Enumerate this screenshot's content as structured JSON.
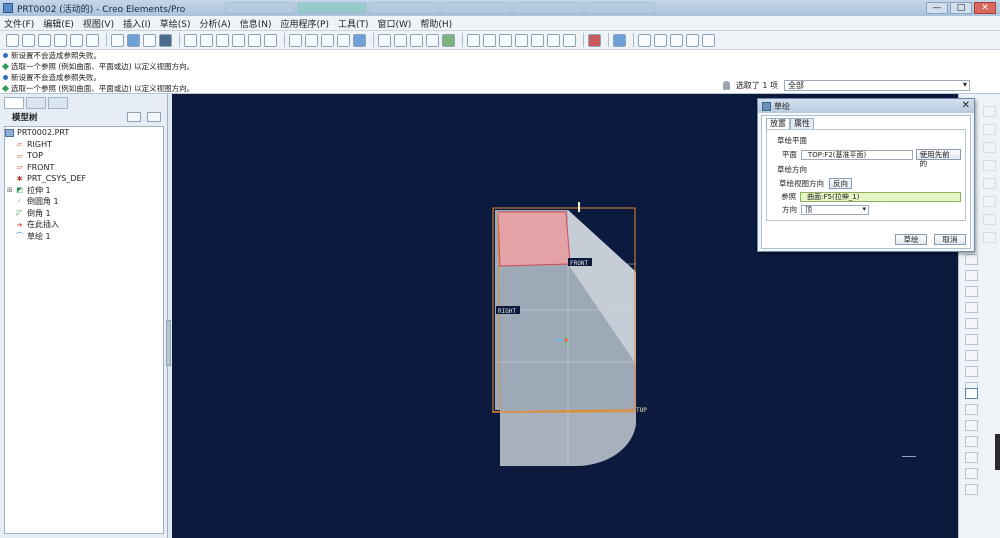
{
  "window": {
    "title": "PRT0002 (活动的) - Creo Elements/Pro",
    "controls": {
      "minimize": "—",
      "maximize": "□",
      "close": "✕"
    }
  },
  "menubar": {
    "items": [
      "文件(F)",
      "编辑(E)",
      "视图(V)",
      "插入(I)",
      "草绘(S)",
      "分析(A)",
      "信息(N)",
      "应用程序(P)",
      "工具(T)",
      "窗口(W)",
      "帮助(H)"
    ]
  },
  "messages": [
    {
      "kind": "info",
      "text": "新设置不会造成参照失败。"
    },
    {
      "kind": "prompt",
      "text": "选取一个参照 (例如曲面、平面或边) 以定义视图方向。"
    },
    {
      "kind": "info",
      "text": "新设置不会造成参照失败。"
    },
    {
      "kind": "prompt",
      "text": "选取一个参照 (例如曲面、平面或边) 以定义视图方向。"
    }
  ],
  "selection": {
    "status": "选取了 1 项",
    "filter": "全部"
  },
  "model_tree": {
    "title": "模型树",
    "items": [
      {
        "label": "PRT0002.PRT",
        "icon": "part-icon",
        "indent": 0,
        "expandable": false
      },
      {
        "label": "RIGHT",
        "icon": "datum-plane-icon",
        "indent": 1,
        "expandable": false
      },
      {
        "label": "TOP",
        "icon": "datum-plane-icon",
        "indent": 1,
        "expandable": false
      },
      {
        "label": "FRONT",
        "icon": "datum-plane-icon",
        "indent": 1,
        "expandable": false
      },
      {
        "label": "PRT_CSYS_DEF",
        "icon": "csys-icon",
        "indent": 1,
        "expandable": false
      },
      {
        "label": "拉伸 1",
        "icon": "extrude-icon",
        "indent": 1,
        "expandable": true
      },
      {
        "label": "倒圆角 1",
        "icon": "round-icon",
        "indent": 1,
        "expandable": false
      },
      {
        "label": "倒角 1",
        "icon": "chamfer-icon",
        "indent": 1,
        "expandable": false
      },
      {
        "label": "在此插入",
        "icon": "insert-here-icon",
        "indent": 1,
        "expandable": false
      },
      {
        "label": "草绘 1",
        "icon": "sketch-icon",
        "indent": 1,
        "expandable": false
      }
    ]
  },
  "viewport": {
    "datum_labels": {
      "front": "FRONT",
      "right": "RIGHT",
      "top": "TOP"
    },
    "colors": {
      "background": "#0b1a3d",
      "body": "#a9b3c0",
      "highlight": "#e3a2a6",
      "datum": "#e08b2e"
    }
  },
  "sketch_dialog": {
    "title": "草绘",
    "tabs": [
      "放置",
      "属性"
    ],
    "active_tab": "放置",
    "sketch_plane": {
      "heading": "草绘平面",
      "plane_label": "平面",
      "plane_value": "TOP:F2(基准平面)",
      "use_previous": "使用先前的"
    },
    "orientation": {
      "heading": "草绘方向",
      "view_dir_label": "草绘视图方向",
      "flip": "反向",
      "reference_label": "参照",
      "reference_value": "曲面:F5(拉伸_1)",
      "direction_label": "方向",
      "direction_value": "顶"
    },
    "ok": "草绘",
    "cancel": "取消"
  }
}
